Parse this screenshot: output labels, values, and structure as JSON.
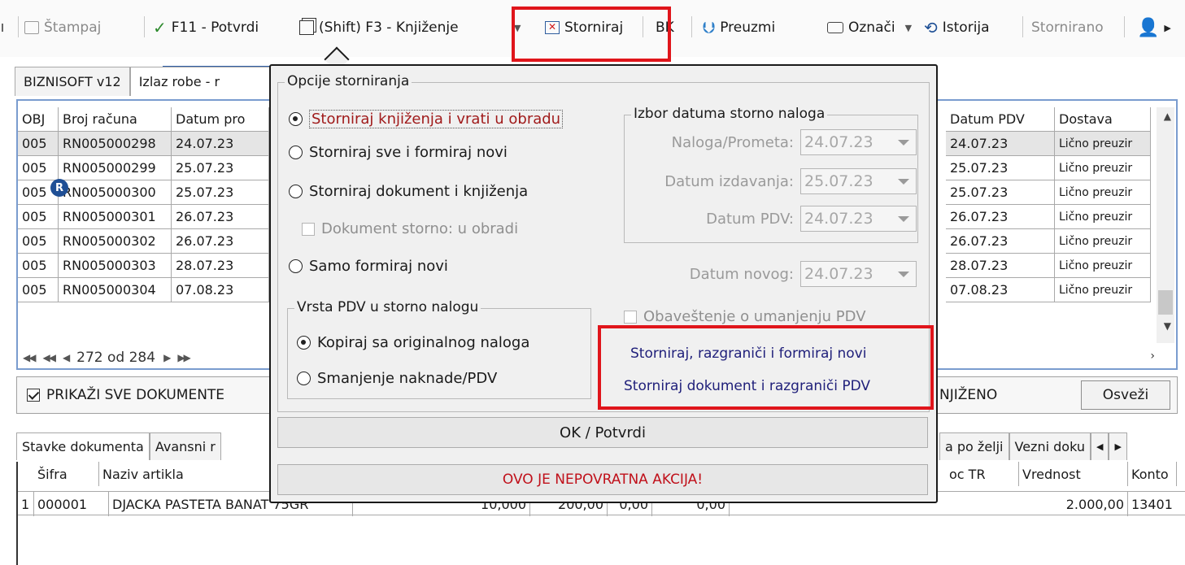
{
  "toolbar": {
    "stampaj": "Štampaj",
    "potvrdi": "F11 - Potvrdi",
    "knjizenje": "(Shift) F3 - Knjiženje",
    "storniraj": "Storniraj",
    "bk": "BK",
    "preuzmi": "Preuzmi",
    "oznaci": "Označi",
    "istorija": "Istorija",
    "stornirano": "Stornirano"
  },
  "tabs": [
    "BIZNISOFT v12",
    "Izlaz robe - r"
  ],
  "grid": {
    "columns": [
      "OBJ",
      "Broj računa",
      "Datum pro"
    ],
    "right_columns": [
      "Datum PDV",
      "Dostava"
    ],
    "rows": [
      {
        "obj": "005",
        "broj": "RN005000298",
        "datum": "24.07.23",
        "pdv": "24.07.23",
        "dostava": "Lično preuzir"
      },
      {
        "obj": "005",
        "broj": "RN005000299",
        "datum": "25.07.23",
        "pdv": "25.07.23",
        "dostava": "Lično preuzir"
      },
      {
        "obj": "005",
        "broj": "RN005000300",
        "datum": "25.07.23",
        "pdv": "25.07.23",
        "dostava": "Lično preuzir"
      },
      {
        "obj": "005",
        "broj": "RN005000301",
        "datum": "26.07.23",
        "pdv": "26.07.23",
        "dostava": "Lično preuzir"
      },
      {
        "obj": "005",
        "broj": "RN005000302",
        "datum": "26.07.23",
        "pdv": "26.07.23",
        "dostava": "Lično preuzir"
      },
      {
        "obj": "005",
        "broj": "RN005000303",
        "datum": "28.07.23",
        "pdv": "28.07.23",
        "dostava": "Lično preuzir"
      },
      {
        "obj": "005",
        "broj": "RN005000304",
        "datum": "07.08.23",
        "pdv": "07.08.23",
        "dostava": "Lično preuzir"
      }
    ],
    "badge": "R",
    "pager_text": "272 od 284"
  },
  "filter": {
    "prikazi_label": "PRIKAŽI SVE DOKUMENTE",
    "knjizeno_label": "NJIŽENO",
    "osvezi": "Osveži"
  },
  "bottom_tabs": [
    "Stavke dokumenta",
    "Avansni r",
    "a po želji",
    "Vezni doku"
  ],
  "items": {
    "columns": [
      "Šifra",
      "Naziv artikla",
      "oc TR",
      "Vrednost",
      "Konto"
    ],
    "row": {
      "no": "1",
      "sifra": "000001",
      "naziv": "DJACKA PASTETA BANAT 75GR",
      "c1": "10,000",
      "c2": "200,00",
      "c3": "0,00",
      "c4": "0,00",
      "vrednost": "2.000,00",
      "konto": "13401"
    }
  },
  "popup": {
    "group_title": "Opcije storniranja",
    "options": [
      {
        "label": "Storniraj knjiženja i vrati u obradu",
        "checked": true
      },
      {
        "label": "Storniraj sve i formiraj novi",
        "checked": false
      },
      {
        "label": "Storniraj dokument i knjiženja",
        "checked": false
      }
    ],
    "dokument_storno": "Dokument storno: u obradi",
    "samo_formiraj": "Samo formiraj novi",
    "vrsta_pdv_title": "Vrsta PDV u storno nalogu",
    "vrsta_pdv_options": [
      {
        "label": "Kopiraj sa originalnog naloga",
        "checked": true
      },
      {
        "label": "Smanjenje naknade/PDV",
        "checked": false
      }
    ],
    "izbor_title": "Izbor datuma storno naloga",
    "dates": [
      {
        "label": "Naloga/Prometa:",
        "value": "24.07.23"
      },
      {
        "label": "Datum izdavanja:",
        "value": "25.07.23"
      },
      {
        "label": "Datum PDV:",
        "value": "24.07.23"
      }
    ],
    "datum_novog_label": "Datum novog:",
    "datum_novog_value": "24.07.23",
    "obavestenje": "Obaveštenje o umanjenju PDV",
    "links": [
      "Storniraj, razgraniči i formiraj novi",
      "Storniraj dokument i razgraniči PDV"
    ],
    "ok": "OK / Potvrdi",
    "warning": "OVO JE NEPOVRATNA AKCIJA!"
  },
  "colors": {
    "highlight": "#e0151b",
    "accent": "#2f5fa8",
    "warning": "#c0101a",
    "link": "#1f1f7a"
  }
}
